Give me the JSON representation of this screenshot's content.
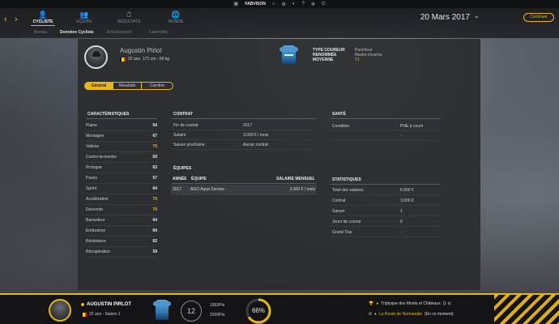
{
  "topbar": {
    "user": "FABVISON",
    "icons": [
      "home-icon",
      "gamepad-icon",
      "help-icon",
      "gear-icon",
      "power-icon"
    ]
  },
  "nav": {
    "tabs": [
      {
        "label": "CYCLISTE",
        "icon": "person-icon",
        "active": true
      },
      {
        "label": "EQUIPE",
        "icon": "people-icon",
        "active": false
      },
      {
        "label": "RESULTATS",
        "icon": "stopwatch-icon",
        "active": false
      },
      {
        "label": "MONDE",
        "icon": "globe-icon",
        "active": false
      }
    ],
    "subtabs": [
      "Bureau",
      "Données Cycliste",
      "Entraînement",
      "Calendrier"
    ],
    "active_subtab": "Données Cycliste",
    "date": "20 Mars 2017",
    "continue_label": "Continuer"
  },
  "rider": {
    "name": "Augustin Pirlot",
    "age": "22 ans",
    "size": "171 cm - 69 kg",
    "flag_colors": [
      "#111111",
      "#f2d21b",
      "#d62a2a"
    ],
    "type_label": "TYPE COUREUR",
    "type_value": "Puncheur",
    "renown_label": "RENOMMÉE",
    "renown_value": "Illustre inconnu",
    "average_label": "MOYENNE",
    "average_value": "71"
  },
  "profile_tabs": [
    "Général",
    "Résultats",
    "Carrière"
  ],
  "characteristics": {
    "title": "CARACTÉRISTIQUES",
    "rows": [
      {
        "label": "Plaine",
        "value": "64",
        "highlight": false
      },
      {
        "label": "Montagne",
        "value": "67",
        "highlight": false
      },
      {
        "label": "Vallons",
        "value": "75",
        "highlight": true
      },
      {
        "label": "Contre-la-montre",
        "value": "59",
        "highlight": false
      },
      {
        "label": "Prologue",
        "value": "63",
        "highlight": false
      },
      {
        "label": "Pavés",
        "value": "57",
        "highlight": false
      },
      {
        "label": "Sprint",
        "value": "64",
        "highlight": false
      },
      {
        "label": "Accélération",
        "value": "75",
        "highlight": true
      },
      {
        "label": "Descente",
        "value": "70",
        "highlight": true
      },
      {
        "label": "Baroudeur",
        "value": "64",
        "highlight": false
      },
      {
        "label": "Endurance",
        "value": "64",
        "highlight": false
      },
      {
        "label": "Résistance",
        "value": "62",
        "highlight": false
      },
      {
        "label": "Récupération",
        "value": "59",
        "highlight": false
      }
    ]
  },
  "contract": {
    "title": "CONTRAT",
    "rows": [
      {
        "label": "Fin de contrat",
        "value": "2017"
      },
      {
        "label": "Salaire",
        "value": "3.000 € / mois"
      },
      {
        "label": "Saison prochaine",
        "value": "Aucun contrat"
      }
    ]
  },
  "teams": {
    "title": "ÉQUIPES",
    "headers": {
      "year": "ANNÉE",
      "team": "ÉQUIPE",
      "salary": "SALAIRE MENSUEL"
    },
    "rows": [
      {
        "year": "2017",
        "team": "AGO Aqua Service",
        "salary": "3.000 € / mois"
      }
    ]
  },
  "health": {
    "title": "SANTÉ",
    "rows": [
      {
        "label": "Condition",
        "value": "PHE à courir"
      }
    ],
    "extra": "-"
  },
  "statistics": {
    "title": "STATISTIQUES",
    "rows": [
      {
        "label": "Total des salaires",
        "value": "6.000 €"
      },
      {
        "label": "Contrat",
        "value": "3.000 €"
      },
      {
        "label": "Saison",
        "value": "1"
      },
      {
        "label": "Jours de course",
        "value": "6"
      },
      {
        "label": "Grand Tour",
        "value": "-"
      }
    ]
  },
  "bottom": {
    "name": "AUGUSTIN PIRLOT",
    "info": "22 ans - Saison 1",
    "number": "12",
    "points_1": "1902Pts",
    "points_2": "2200Pts",
    "gauge_value": 0.66,
    "gauge_label": "66%",
    "race_1": "Triptyque des Monts et Châteaux",
    "race_1_time": "(1 s)",
    "race_2": "La Route de Normandie",
    "race_2_time": "(En ce moment)"
  },
  "colors": {
    "accent": "#e7b718",
    "panel": "#2a2b2f",
    "gauge_track": "#3b3c40"
  }
}
